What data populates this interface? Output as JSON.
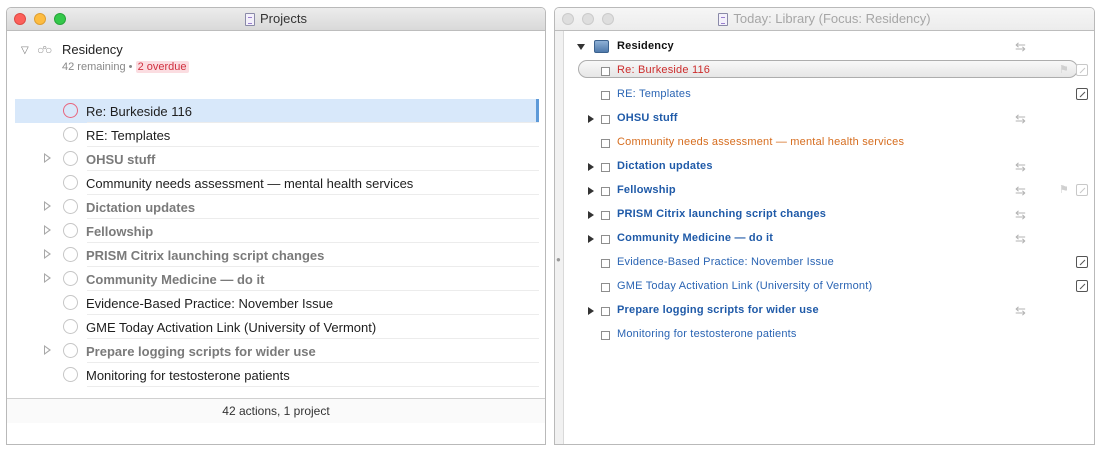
{
  "left_window": {
    "title": "Projects",
    "project": {
      "title": "Residency",
      "remaining": "42 remaining",
      "separator": "•",
      "overdue": "2 overdue"
    },
    "rows": [
      {
        "label": "Re: Burkeside 116",
        "bold": false,
        "group": false,
        "selected": true,
        "overdue": true
      },
      {
        "label": "RE: Templates",
        "bold": false,
        "group": false
      },
      {
        "label": "OHSU stuff",
        "bold": true,
        "group": true
      },
      {
        "label": "Community needs assessment — mental health services",
        "bold": false,
        "group": false
      },
      {
        "label": "Dictation updates",
        "bold": true,
        "group": true
      },
      {
        "label": "Fellowship",
        "bold": true,
        "group": true
      },
      {
        "label": "PRISM Citrix launching script changes",
        "bold": true,
        "group": true
      },
      {
        "label": "Community Medicine — do it",
        "bold": true,
        "group": true
      },
      {
        "label": "Evidence-Based Practice: November Issue",
        "bold": false,
        "group": false
      },
      {
        "label": "GME Today Activation Link (University of Vermont)",
        "bold": false,
        "group": false
      },
      {
        "label": "Prepare logging scripts for wider use",
        "bold": true,
        "group": true
      },
      {
        "label": "Monitoring for testosterone patients",
        "bold": false,
        "group": false
      }
    ],
    "footer": "42 actions, 1 project"
  },
  "right_window": {
    "title": "Today: Library (Focus: Residency)",
    "project_row": {
      "label": "Residency"
    },
    "rows": [
      {
        "label": "Re: Burkeside 116",
        "style": "red",
        "group": false,
        "highlight": true,
        "arrows": false,
        "flag": true,
        "note": "faint"
      },
      {
        "label": "RE: Templates",
        "style": "normal",
        "group": false,
        "arrows": false,
        "note": "dark"
      },
      {
        "label": "OHSU stuff",
        "style": "bold",
        "group": true,
        "arrows": true
      },
      {
        "label": "Community needs assessment — mental health services",
        "style": "orange",
        "group": false,
        "arrows": false
      },
      {
        "label": "Dictation updates",
        "style": "bold",
        "group": true,
        "arrows": true
      },
      {
        "label": "Fellowship",
        "style": "bold",
        "group": true,
        "arrows": true,
        "flag": true,
        "note": "faint"
      },
      {
        "label": "PRISM Citrix launching script changes",
        "style": "bold",
        "group": true,
        "arrows": true
      },
      {
        "label": "Community Medicine — do it",
        "style": "bold",
        "group": true,
        "arrows": true
      },
      {
        "label": "Evidence-Based Practice: November Issue",
        "style": "normal",
        "group": false,
        "arrows": false,
        "note": "dark"
      },
      {
        "label": "GME Today Activation Link (University of Vermont)",
        "style": "normal",
        "group": false,
        "arrows": false,
        "note": "dark"
      },
      {
        "label": "Prepare logging scripts for wider use",
        "style": "bold",
        "group": true,
        "arrows": true
      },
      {
        "label": "Monitoring for testosterone patients",
        "style": "normal",
        "group": false,
        "arrows": false
      }
    ]
  },
  "icons": {
    "project": "project-outline-icon",
    "status_circle": "status-circle-icon",
    "library": "library-icon",
    "repeat_arrows": "repeat-arrows-icon",
    "flag": "flag-icon",
    "note": "note-icon"
  },
  "colors": {
    "overdue_red": "#e8657d",
    "selection_blue": "#d8e8fa",
    "link_blue": "#2a64b3",
    "orange": "#d66d1f"
  }
}
